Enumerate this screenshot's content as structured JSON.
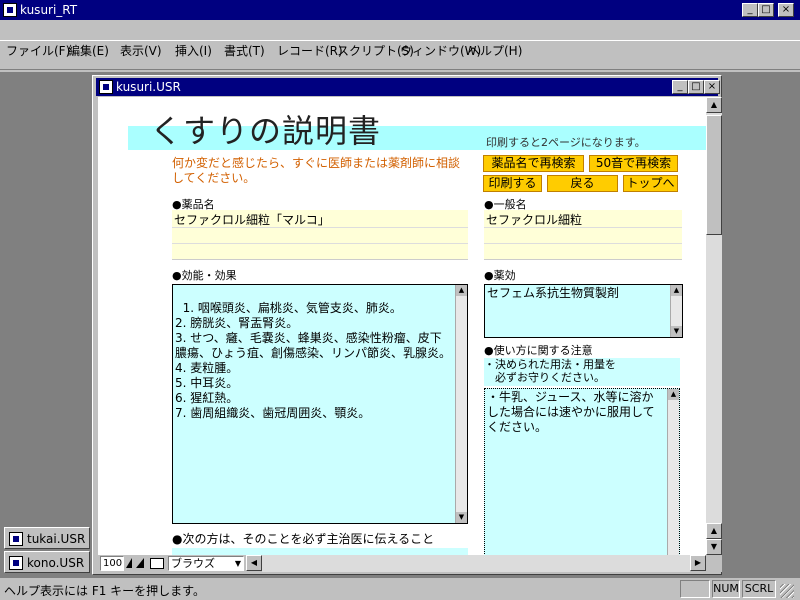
{
  "app": {
    "title": "kusuri_RT"
  },
  "menu": [
    "ファイル(F)",
    "編集(E)",
    "表示(V)",
    "挿入(I)",
    "書式(T)",
    "レコード(R)",
    "スクリプト(S)",
    "ウィンドウ(W)",
    "ヘルプ(H)"
  ],
  "child": {
    "title": "kusuri.USR"
  },
  "page": {
    "title": "くすりの説明書",
    "print_note": "印刷すると2ページになります。",
    "warning": "何か変だと感じたら、すぐに医師または薬剤師に相談してください。",
    "buttons": {
      "search_name": "薬品名で再検索",
      "search_50": "50音で再検索",
      "print": "印刷する",
      "back": "戻る",
      "top": "トップへ"
    },
    "drug_name_label": "●薬品名",
    "drug_name": "セファクロル細粒「マルコ」",
    "generic_label": "●一般名",
    "generic_name": "セファクロル細粒",
    "effect_label": "●効能・効果",
    "effect_text": "1. 咽喉頭炎、扁桃炎、気管支炎、肺炎。\n2. 膀胱炎、腎盂腎炎。\n3. せつ、癰、毛嚢炎、蜂巣炎、感染性粉瘤、皮下膿瘍、ひょう疽、創傷感染、リンパ節炎、乳腺炎。\n4. 麦粒腫。\n5. 中耳炎。\n6. 猩紅熱。\n7. 歯周組織炎、歯冠周囲炎、顎炎。",
    "drug_effect_label": "●薬効",
    "drug_effect": "セフェム系抗生物質製剤",
    "usage_label": "●使い方に関する注意",
    "usage_note": "・決められた用法・用量を\n　必ずお守りください。",
    "usage_text": "・牛乳、ジュース、水等に溶かした場合には速やかに服用してください。",
    "doctor_label": "●次の方は、そのことを必ず主治医に伝えること"
  },
  "bottom": {
    "zoom": "100",
    "mode": "ブラウズ"
  },
  "minimized": [
    {
      "title": "tukai.USR"
    },
    {
      "title": "kono.USR"
    }
  ],
  "status": {
    "text": "ヘルプ表示には F1 キーを押します。",
    "num": "NUM",
    "scrl": "SCRL"
  }
}
